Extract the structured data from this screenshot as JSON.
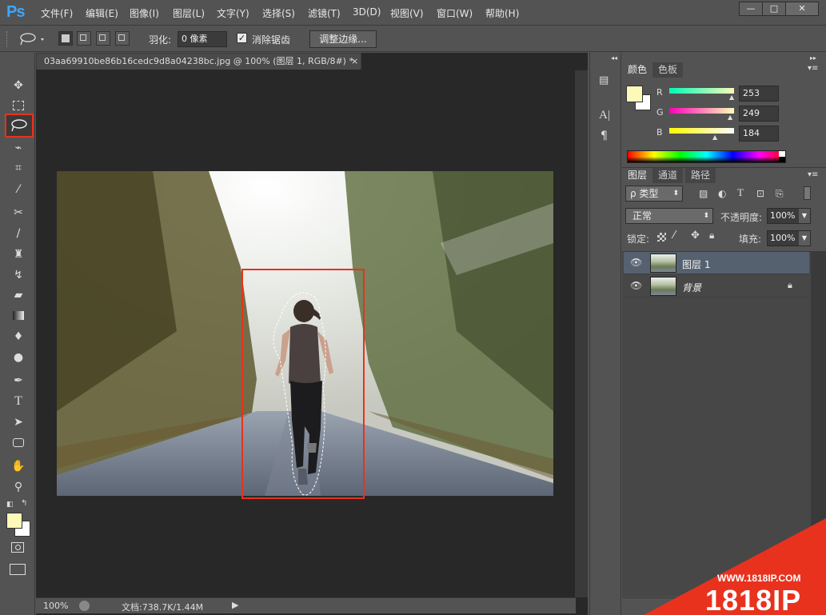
{
  "app": {
    "logo": "Ps"
  },
  "menu": [
    "文件(F)",
    "编辑(E)",
    "图像(I)",
    "图层(L)",
    "文字(Y)",
    "选择(S)",
    "滤镜(T)",
    "3D(D)",
    "视图(V)",
    "窗口(W)",
    "帮助(H)"
  ],
  "window_controls": {
    "minimize": "—",
    "maximize": "□",
    "close": "✕"
  },
  "options": {
    "feather_label": "羽化:",
    "feather_value": "0 像素",
    "antialias_label": "消除锯齿",
    "antialias_checked": true,
    "refine_edge_label": "调整边缘..."
  },
  "document": {
    "tab_title": "03aa69910be86b16cedc9d8a04238bc.jpg @ 100% (图层 1, RGB/8#) *",
    "close": "×",
    "zoom": "100%",
    "doc_info": "文档:738.7K/1.44M"
  },
  "color_panel": {
    "tabs": [
      "颜色",
      "色板"
    ],
    "r_label": "R",
    "g_label": "G",
    "b_label": "B",
    "r": 253,
    "g": 249,
    "b": 184,
    "foreground": "#fdf9b8",
    "background": "#ffffff"
  },
  "layers_panel": {
    "tabs": [
      "图层",
      "通道",
      "路径"
    ],
    "filter_label": "ρ 类型",
    "blend_mode": "正常",
    "opacity_label": "不透明度:",
    "opacity": "100%",
    "lock_label": "锁定:",
    "fill_label": "填充:",
    "fill": "100%",
    "layers": [
      {
        "name": "图层 1",
        "selected": true
      },
      {
        "name": "背景",
        "selected": false,
        "locked": true
      }
    ]
  },
  "watermark": {
    "url": "WWW.1818IP.COM",
    "brand": "1818IP"
  },
  "accent": "#e8321e"
}
